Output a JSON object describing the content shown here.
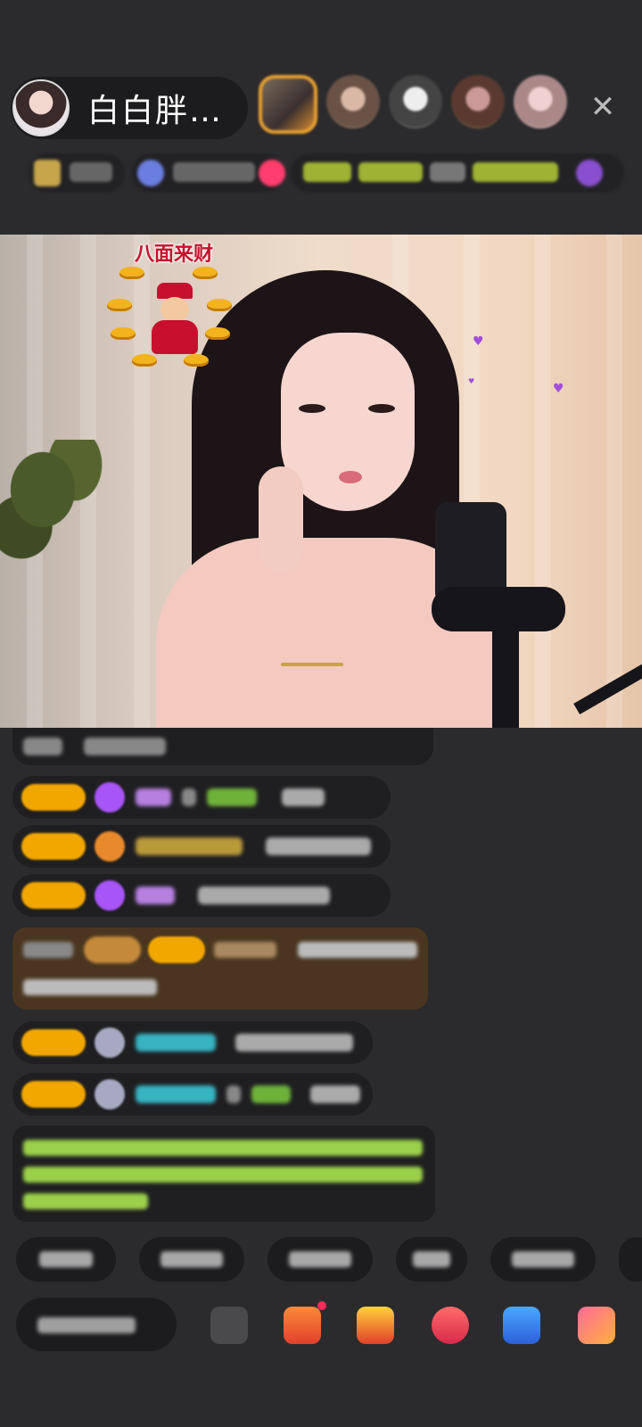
{
  "host": {
    "name": "白白胖…"
  },
  "video": {
    "sticker_text": "八面来财"
  },
  "colors": {
    "background": "#2b2b2d",
    "badge": "#f2a700",
    "chat_bubble": "#1f1f21",
    "highlight_bubble": "#4a3620",
    "green_text": "#9bd14a",
    "cyan_name": "#37b3c2",
    "purple_gem": "#a855f7"
  },
  "icons": {
    "close": "close-icon",
    "gift": "gift-icon",
    "more": "more-icon"
  }
}
